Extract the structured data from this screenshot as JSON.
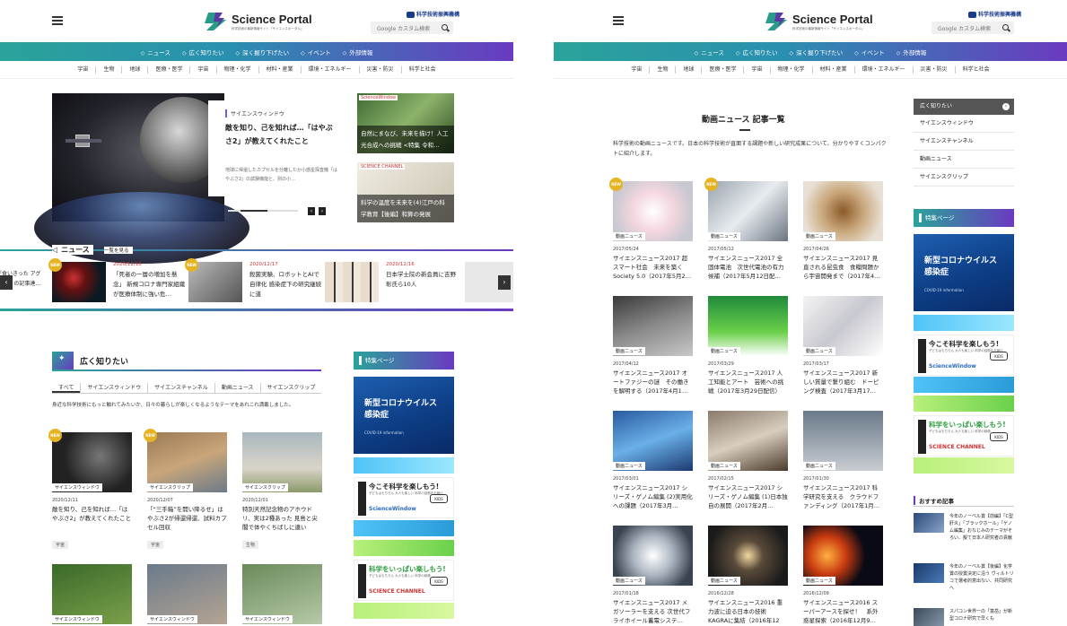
{
  "header": {
    "logo_text": "Science Portal",
    "logo_sub": "科学技術の最新情報サイト「サイエンスポータル」",
    "agency": "科学技術振興機構",
    "search_placeholder": "Google カスタム検索"
  },
  "nav_main": [
    "ニュース",
    "広く知りたい",
    "深く掘り下げたい",
    "イベント",
    "外部情報"
  ],
  "nav_sub": [
    "宇宙",
    "生物",
    "地球",
    "医療・医学",
    "宇宙",
    "物理・化学",
    "材料・産業",
    "環境・エネルギー",
    "災害・防災",
    "科学と社会"
  ],
  "left": {
    "hero": {
      "tag": "サイエンスウィンドウ",
      "title": "敵を知り、己を知れば…「はやぶさ2」が教えてくれたこと",
      "desc": "地球に帰還したカプセルを分離したか小惑星探査機「はやぶさ2」の試験機能と、別の小…"
    },
    "side_tiles": [
      {
        "logo": "ScienceWindow",
        "caption": "自然にまなび、未来を描け！人工光合成への挑戦 <特集 令和…"
      },
      {
        "logo": "SCIENCE CHANNEL",
        "caption": "科学の温度を未来を(4)江戸の科学教育【後編】和算の発展"
      }
    ],
    "news_head": "ニュース",
    "news_more": "一覧を見る",
    "news_partial": "ギ食いきった アグラ202 の記事達…",
    "news": [
      {
        "date": "2020/12/18",
        "title": "「死者の一層の増加を懸念」 新規コロナ専門家組織が医療体制に強い危…",
        "badge": "NEW"
      },
      {
        "date": "2020/12/17",
        "title": "殺菌実験、ロボットとAIで自律化 感染症下の研究継続に道",
        "badge": "NEW"
      },
      {
        "date": "2020/12/16",
        "title": "日本学士院の新会員に吉野彰氏ら10人",
        "badge": ""
      }
    ],
    "section_title": "広く知りたい",
    "tabs": [
      "すべて",
      "サイエンスウィンドウ",
      "サイエンスチャンネル",
      "動画ニュース",
      "サイエンスクリップ"
    ],
    "section_desc": "身近な科学技術にもっと触れてみたいか、日々の暮らしが楽しくなるようなテーマをあれこれ満載しました。",
    "cards": [
      {
        "cat": "サイエンスウィンドウ",
        "date": "2020/12/11",
        "title": "敵を知り、己を知れば…「はやぶさ2」が教えてくれたこと",
        "tag": "宇宙",
        "badge": "NEW"
      },
      {
        "cat": "サイエンスクリップ",
        "date": "2020/12/07",
        "title": "「“三手箱”を開い降るせ」はやぶさ2が帰還帰還、試料カプセル回収",
        "tag": "宇宙",
        "badge": "NEW"
      },
      {
        "cat": "サイエンスクリップ",
        "date": "2020/12/01",
        "title": "特別天然記念物のアホウドリ、実は2種あった 見島と尖閣で体やくちばしに違い",
        "tag": "生物",
        "badge": ""
      }
    ],
    "cards_row2": [
      "サイエンスウィンドウ",
      "サイエンスウィンドウ",
      "サイエンスウィンドウ"
    ],
    "feature_label": "特集ページ",
    "corona": {
      "line1": "新型コロナウイルス",
      "line2": "感染症",
      "sub": "COVID-19 information"
    },
    "banner1": {
      "title": "今こそ科学を楽しもう!",
      "sub": "子どもはもちろん 大人も楽しい 科学の話題をお届け",
      "brand": "ScienceWindow",
      "kids": "KIDS"
    },
    "banner2": {
      "title": "科学をいっぱい楽しもう!",
      "sub": "子どもはもちろん 大人も楽しい 科学の映像",
      "brand": "SCIENCE CHANNEL",
      "kids": "KIDS"
    }
  },
  "right": {
    "page_title": "動画ニュース 記事一覧",
    "page_desc": "科学技術の動画ニュースです。日本の科学技術が直面する課題や新しい研究成果について、分かりやすくコンパクトに紹介します。",
    "menu_head": "広く知りたい",
    "menu": [
      "サイエンスウィンドウ",
      "サイエンスチャンネル",
      "動画ニュース",
      "サイエンスクリップ"
    ],
    "feature_label": "特集ページ",
    "corona": {
      "line1": "新型コロナウイルス",
      "line2": "感染症",
      "sub": "COVID-19 information"
    },
    "banner1": {
      "title": "今こそ科学を楽しもう!",
      "sub": "子どもはもちろん 大人も楽しい 科学の話題をお届け",
      "brand": "ScienceWindow",
      "kids": "KIDS"
    },
    "banner2": {
      "title": "科学をいっぱい楽しもう!",
      "sub": "子どもはもちろん 大人も楽しい 科学の映像",
      "brand": "SCIENCE CHANNEL",
      "kids": "KIDS"
    },
    "rec_head": "おすすめ記事",
    "rec": [
      "今年のノーベル賞【前編】「C型肝炎」「ブラックホール」「ゲノム編集」おなじみのテーマがそろい、擬て日本人研究者の貢献も",
      "今年のノーベル賞【後編】化学賞の授賞決定に沿う ヴィルトリコで選考的意出ない、共同研究へ",
      "スパコン世界一の「富岳」が新型コロナ研究で早くも"
    ],
    "cat_label": "動画ニュース",
    "videos": [
      {
        "date": "2017/05/24",
        "title": "サイエンスニュース2017 超スマート社会　未来を築くSociety 5.0（2017年5月2…",
        "badge": "NEW"
      },
      {
        "date": "2017/05/12",
        "title": "サイエンスニュース2017 全固体電池　次世代電池の有力候補（2017年5月12日配…",
        "badge": "NEW"
      },
      {
        "date": "2017/04/26",
        "title": "サイエンスニュース2017 見直される昆虫食　食糧問題から宇宙開発まで（2017年4…",
        "badge": ""
      },
      {
        "date": "2017/04/12",
        "title": "サイエンスニュース2017 オートファジーの謎　その働きを解明する（2017年4月1…",
        "badge": ""
      },
      {
        "date": "2017/03/29",
        "title": "サイエンスニュース2017 人工知能とアート　芸術への挑戦（2017年3月29日配信）",
        "badge": ""
      },
      {
        "date": "2017/03/17",
        "title": "サイエンスニュース2017 新しい質量で繋り組む　ドーピング検査（2017年3月17…",
        "badge": ""
      },
      {
        "date": "2017/03/01",
        "title": "サイエンスニュース2017 シリーズ・ゲノム編集 (2)実用化への課題（2017年3月…",
        "badge": ""
      },
      {
        "date": "2017/02/15",
        "title": "サイエンスニュース2017 シリーズ・ゲノム編集 (1)日本独自の展開（2017年2月…",
        "badge": ""
      },
      {
        "date": "2017/01/30",
        "title": "サイエンスニュース2017 科学研究を支える　クラウドファンディング（2017年1月…",
        "badge": ""
      },
      {
        "date": "2017/01/18",
        "title": "サイエンスニュース2017 メガソーラーを支える 次世代フライホイール蓄電システ…",
        "badge": ""
      },
      {
        "date": "2016/12/28",
        "title": "サイエンスニュース2016 重力波に迫る日本の技術　KAGRAに集結（2016年12月…",
        "badge": ""
      },
      {
        "date": "2016/12/09",
        "title": "サイエンスニュース2016 スーパーアースを探せ！　系外惑星探索（2016年12月9…",
        "badge": ""
      }
    ]
  },
  "colors": {
    "teal": "#2aa39a",
    "purple": "#6a3ac0",
    "new_badge": "#e6b423",
    "date_red": "#cc3333"
  }
}
